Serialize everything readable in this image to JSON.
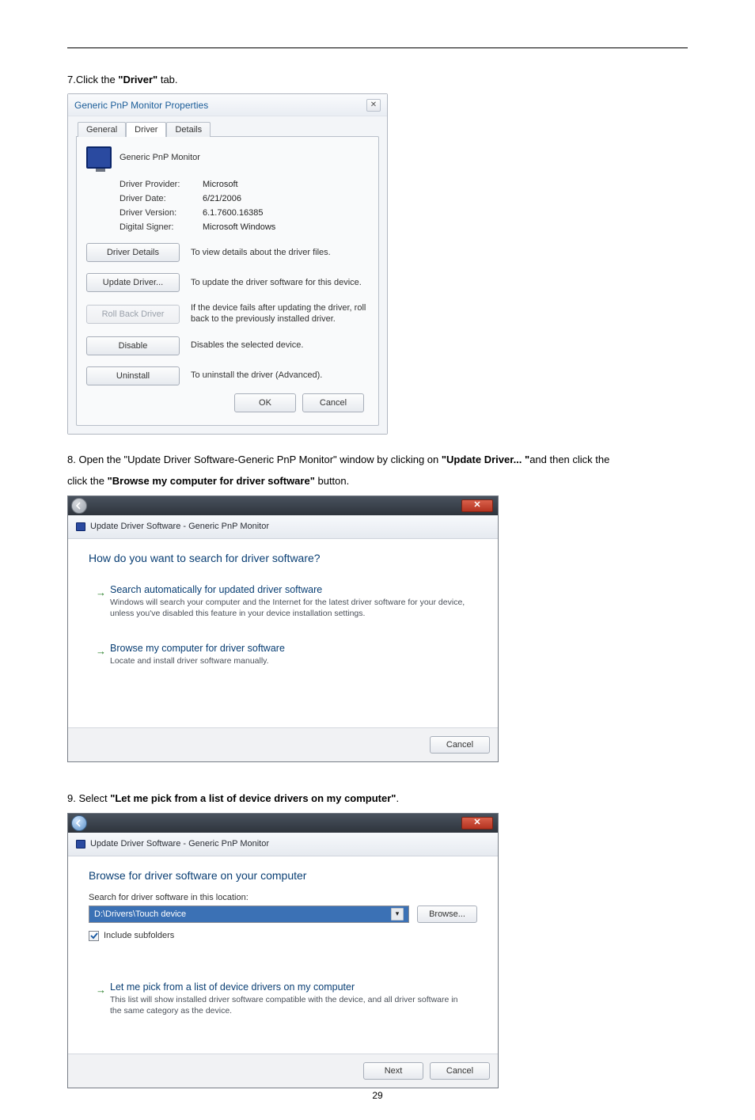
{
  "page_number": "29",
  "steps": {
    "s7_pre": "7.Click the ",
    "s7_bold": "\"Driver\"",
    "s7_post": " tab.",
    "s8_pre": "8. Open the \"Update Driver Software-Generic PnP Monitor\" window by clicking on ",
    "s8_bold": "\"Update Driver... \"",
    "s8_mid": "and then click the ",
    "s8_bold2": "\"Browse my computer for driver software\"",
    "s8_post": " button.",
    "s9_pre": "9. Select ",
    "s9_bold": "\"Let me pick from a list of device drivers on my computer\"",
    "s9_post": "."
  },
  "dlg1": {
    "title": "Generic PnP Monitor Properties",
    "tabs": [
      "General",
      "Driver",
      "Details"
    ],
    "device_name": "Generic PnP Monitor",
    "rows": [
      {
        "k": "Driver Provider:",
        "v": "Microsoft"
      },
      {
        "k": "Driver Date:",
        "v": "6/21/2006"
      },
      {
        "k": "Driver Version:",
        "v": "6.1.7600.16385"
      },
      {
        "k": "Digital Signer:",
        "v": "Microsoft Windows"
      }
    ],
    "btns": [
      {
        "label": "Driver Details",
        "desc": "To view details about the driver files."
      },
      {
        "label": "Update Driver...",
        "desc": "To update the driver software for this device."
      },
      {
        "label": "Roll Back Driver",
        "desc": "If the device fails after updating the driver, roll back to the previously installed driver."
      },
      {
        "label": "Disable",
        "desc": "Disables the selected device."
      },
      {
        "label": "Uninstall",
        "desc": "To uninstall the driver (Advanced)."
      }
    ],
    "ok": "OK",
    "cancel": "Cancel"
  },
  "dlg2": {
    "crumb": "Update Driver Software - Generic PnP Monitor",
    "heading": "How do you want to search for driver software?",
    "opt1_t": "Search automatically for updated driver software",
    "opt1_d": "Windows will search your computer and the Internet for the latest driver software for your device, unless you've disabled this feature in your device installation settings.",
    "opt2_t": "Browse my computer for driver software",
    "opt2_d": "Locate and install driver software manually.",
    "cancel": "Cancel"
  },
  "dlg3": {
    "crumb": "Update Driver Software - Generic PnP Monitor",
    "heading": "Browse for driver software on your computer",
    "search_label": "Search for driver software in this location:",
    "path": "D:\\Drivers\\Touch device",
    "browse": "Browse...",
    "include": "Include subfolders",
    "opt_t": "Let me pick from a list of device drivers on my computer",
    "opt_d": "This list will show installed driver software compatible with the device, and all driver software in the same category as the device.",
    "next": "Next",
    "cancel": "Cancel"
  }
}
